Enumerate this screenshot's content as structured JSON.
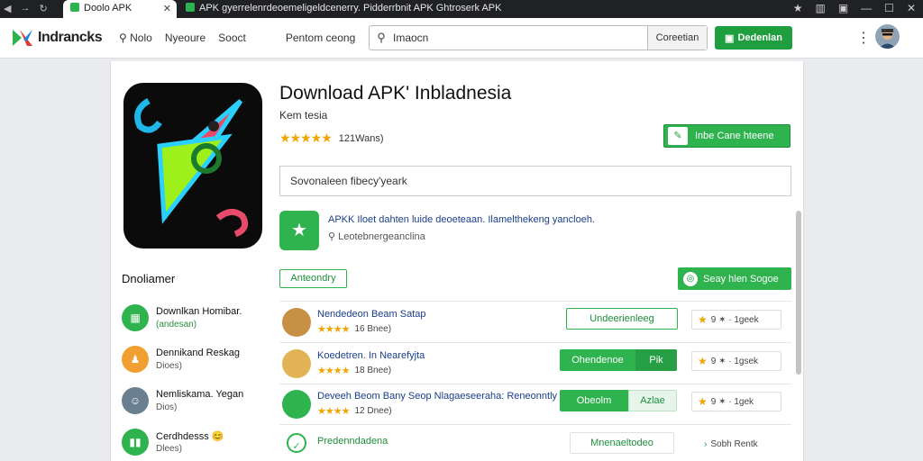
{
  "browser": {
    "tabs": [
      {
        "title": "Doolo APK",
        "active": true
      },
      {
        "title": "APK gyerrelenrdeoemeligeldcenerry. Pidderrbnit APK Ghtroserk APK",
        "active": false
      }
    ]
  },
  "header": {
    "brand": "Indrancks",
    "nav": [
      "Nolo",
      "Nyeoure",
      "Sooct",
      "Pentom ceong"
    ],
    "search_value": "Imaocn",
    "search_button": "Coreetian",
    "download_button": "Dedenlan",
    "more_label": "⋮"
  },
  "app": {
    "title": "Download APK' Inbladnesia",
    "developer": "Kem tesia",
    "stars": "★★★★★",
    "rating_count": "121Wans)",
    "install_button": "Inbe Cane hteene",
    "description": "Sovonaleen fibecy'yeark",
    "info_text": "APKK Iloet dahten luide deoeteaan. Ilamelthekeng yancloeh.",
    "info_sub": "Leotebnergeanclina"
  },
  "sidebar": {
    "title": "Dnoliamer",
    "items": [
      {
        "name": "Downlkan Homibar.",
        "sub": "(andesan)",
        "color": "#2fb34f",
        "icon": "▦"
      },
      {
        "name": "Dennikand Reskag",
        "sub": "Dioes)",
        "color": "#f0a030",
        "icon": "♟"
      },
      {
        "name": "Nemliskama. Yegan",
        "sub": "Dios)",
        "color": "#6a7f8f",
        "icon": "☺"
      },
      {
        "name": "Cerdhdesss 😊",
        "sub": "Dlees)",
        "color": "#2fb34f",
        "icon": "▮▮"
      }
    ]
  },
  "list": {
    "filter_button": "Anteondry",
    "sort_button": "Seay hlen Sogoe",
    "rows": [
      {
        "title": "Nendedeon Beam Satap",
        "stars": "★★★★",
        "meta": "16 Bnee)",
        "action_type": "outline",
        "action": "Undeerienleeg",
        "rating": "9 ✶ ·  1geek",
        "avatar": "#c89044"
      },
      {
        "title": "Koedetren. In Nearefyjta",
        "stars": "★★★★",
        "meta": "18 Bnee)",
        "action_type": "split",
        "action": "Ohendenoe",
        "action_alt": "Pik",
        "rating": "9 ✶ ·  1gsek",
        "avatar": "#e1b354"
      },
      {
        "title": "Deveeh Beom Bany Seop Nlagaeseeraha: Reneonntly",
        "stars": "★★★★",
        "meta": "12 Dnee)",
        "action_type": "split",
        "action": "Obeolm",
        "action_alt": "Azlae",
        "rating": "9 ✶ ·  1gek",
        "avatar": "#2fb34f"
      },
      {
        "title": "Predenndadena",
        "stars": "",
        "meta": "",
        "action_type": "plain",
        "action": "Mnenaeltodeo",
        "rating": "Sobh  Rentk",
        "avatar": "#ffffff"
      }
    ]
  }
}
